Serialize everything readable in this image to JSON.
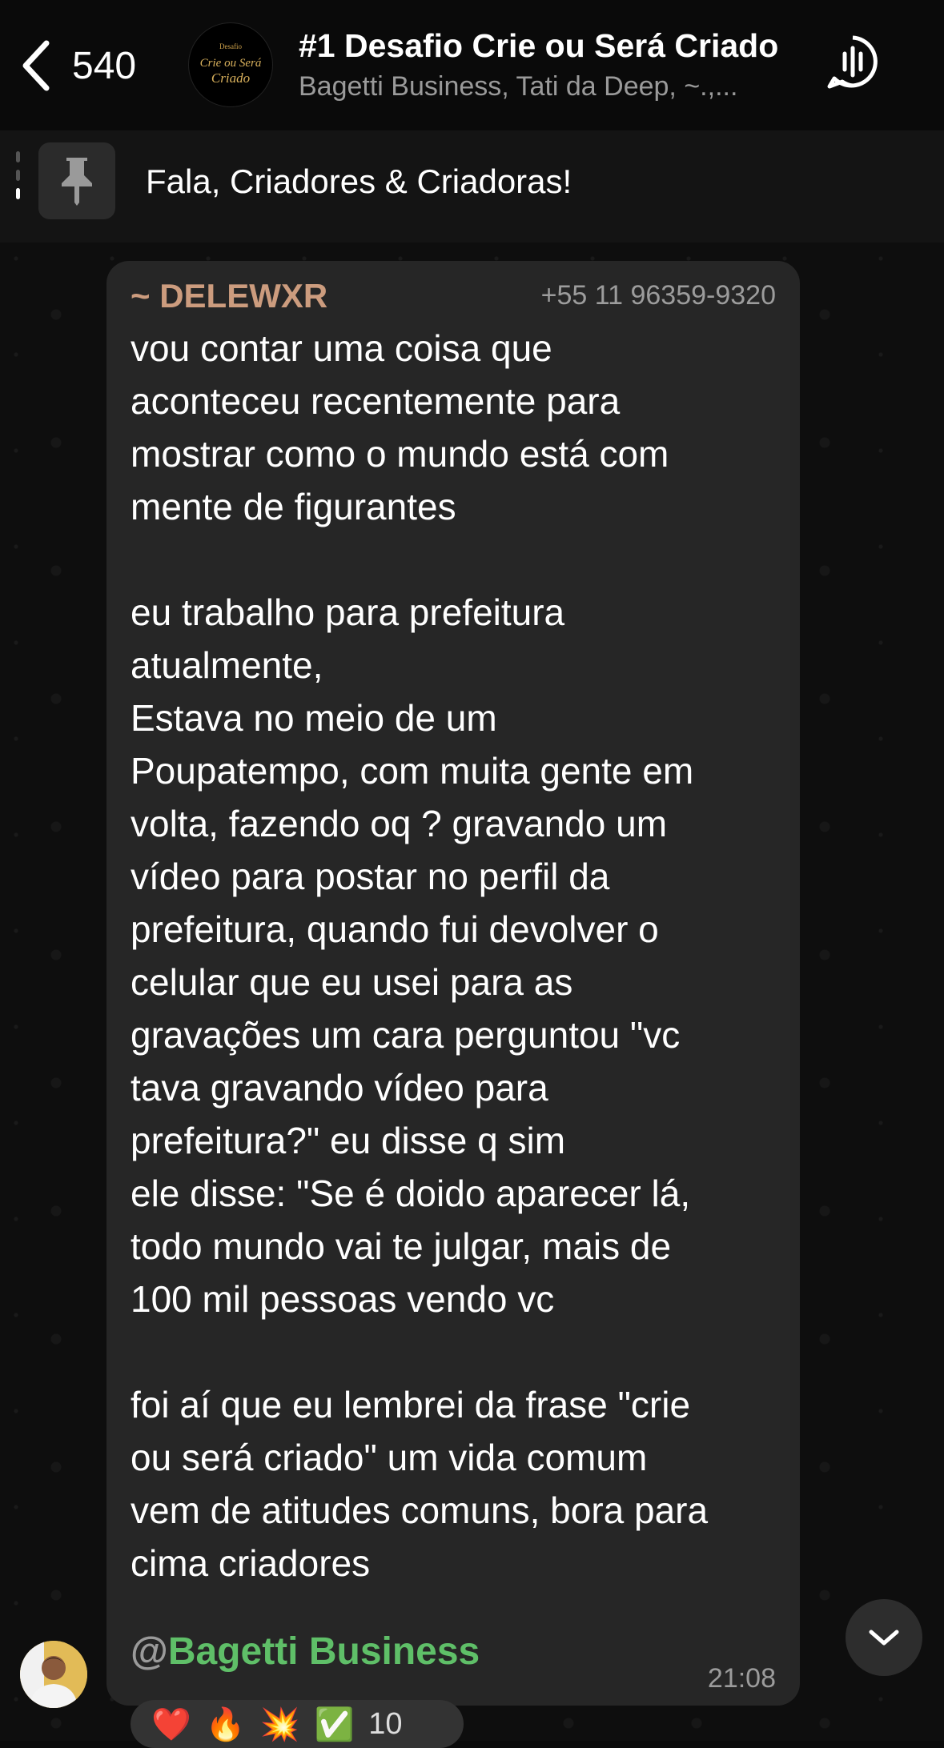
{
  "header": {
    "back_count": "540",
    "title": "#1 Desafio Crie ou Será Criado",
    "subtitle": "Bagetti Business, Tati da Deep, ~.,...",
    "avatar_text": [
      "Desafio",
      "Crie ou Será",
      "Criado"
    ]
  },
  "pinned": {
    "text": "Fala, Criadores & Criadoras!"
  },
  "message": {
    "sender": "~ DELEWXR",
    "phone": "+55 11 96359-9320",
    "body": "vou contar uma coisa que\naconteceu recentemente para\nmostrar como o mundo está com\nmente de figurantes\n\neu trabalho para prefeitura\natualmente,\nEstava no meio de um\nPoupatempo, com muita gente em\nvolta, fazendo oq ? gravando um\nvídeo para postar no perfil da\nprefeitura, quando fui devolver o\ncelular que eu usei para as\ngravações um cara perguntou \"vc\ntava gravando vídeo para\nprefeitura?\" eu disse q sim\nele disse: \"Se é doido aparecer lá,\ntodo mundo vai te julgar, mais de\n100 mil pessoas vendo vc\n\nfoi aí que eu lembrei da frase \"crie\nou será criado\" um vida comum\nvem de atitudes comuns, bora para\ncima criadores",
    "mention_at": "@",
    "mention_name": "Bagetti Business",
    "time": "21:08"
  },
  "reactions": {
    "emojis": [
      "❤️",
      "🔥",
      "💥",
      "✅"
    ],
    "count": "10"
  },
  "colors": {
    "sender": "#cc9c7e",
    "mention": "#5fbf68",
    "bubble": "#262626"
  }
}
